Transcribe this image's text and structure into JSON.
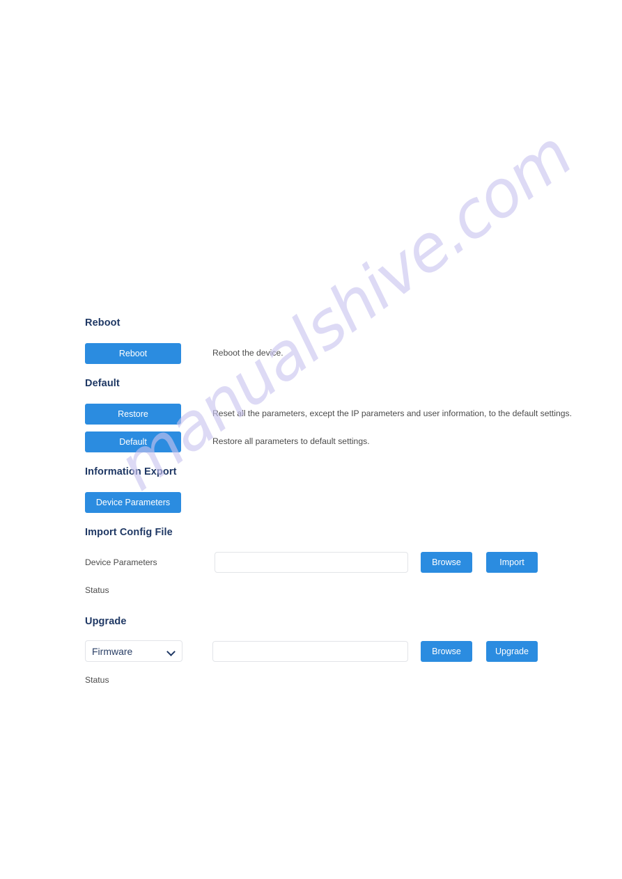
{
  "page": {
    "background_color": "#ffffff",
    "accent_color": "#2b8ce0",
    "heading_color": "#1f3864",
    "body_text_color": "#4a4a4a"
  },
  "watermark": {
    "text": "manualshive.com",
    "color": "#c9c4ef"
  },
  "sections": {
    "reboot": {
      "heading": "Reboot",
      "button_label": "Reboot",
      "description": "Reboot the device."
    },
    "default": {
      "heading": "Default",
      "restore_label": "Restore",
      "restore_description": "Reset all the parameters, except the IP parameters and user information, to the default settings.",
      "default_label": "Default",
      "default_description": "Restore all parameters to default settings."
    },
    "information_export": {
      "heading": "Information Export",
      "button_label": "Device Parameters"
    },
    "import_config_file": {
      "heading": "Import Config File",
      "field_label": "Device Parameters",
      "file_path_value": "",
      "file_path_placeholder": "",
      "browse_label": "Browse",
      "import_label": "Import",
      "status_label": "Status",
      "status_value": ""
    },
    "upgrade": {
      "heading": "Upgrade",
      "type_selected": "Firmware",
      "type_options": [
        "Firmware"
      ],
      "file_path_value": "",
      "file_path_placeholder": "",
      "browse_label": "Browse",
      "upgrade_label": "Upgrade",
      "status_label": "Status",
      "status_value": ""
    }
  }
}
